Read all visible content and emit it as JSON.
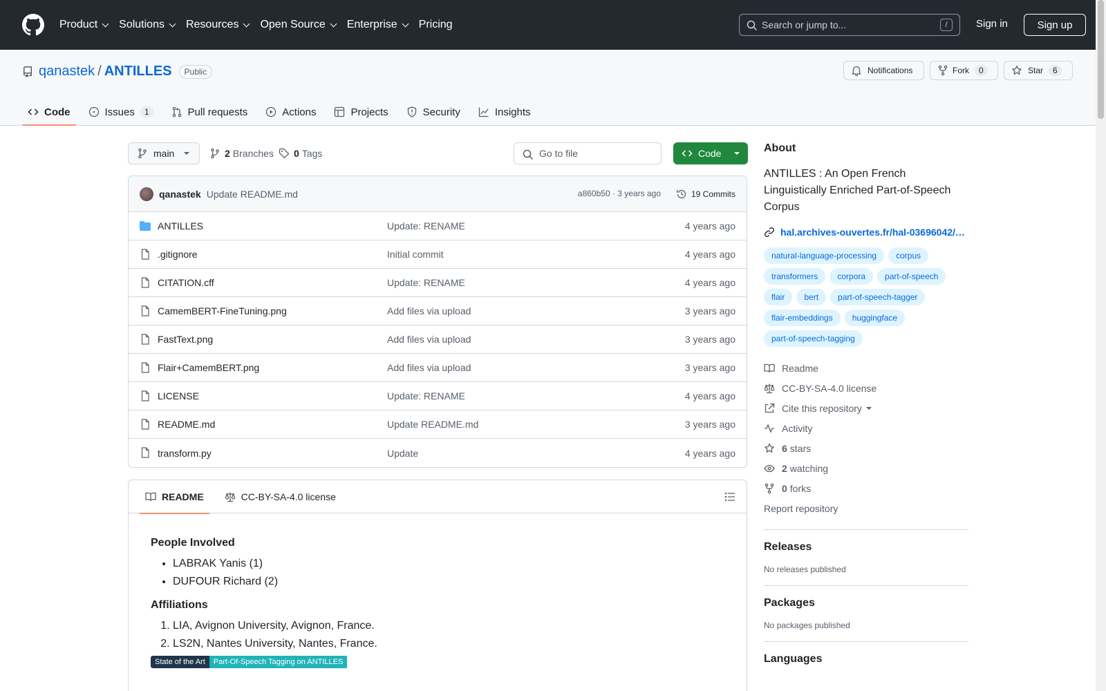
{
  "header": {
    "nav": [
      "Product",
      "Solutions",
      "Resources",
      "Open Source",
      "Enterprise",
      "Pricing"
    ],
    "search_placeholder": "Search or jump to...",
    "slash": "/",
    "signin": "Sign in",
    "signup": "Sign up"
  },
  "repo": {
    "owner": "qanastek",
    "sep": "/",
    "name": "ANTILLES",
    "visibility": "Public",
    "notifications": "Notifications",
    "fork_label": "Fork",
    "fork_count": "0",
    "star_label": "Star",
    "star_count": "6"
  },
  "tabs": [
    {
      "label": "Code"
    },
    {
      "label": "Issues",
      "count": "1"
    },
    {
      "label": "Pull requests"
    },
    {
      "label": "Actions"
    },
    {
      "label": "Projects"
    },
    {
      "label": "Security"
    },
    {
      "label": "Insights"
    }
  ],
  "bar": {
    "branch": "main",
    "branches_count": "2",
    "branches_label": "Branches",
    "tags_count": "0",
    "tags_label": "Tags",
    "goto_placeholder": "Go to file",
    "code_button": "Code"
  },
  "commit": {
    "author": "qanastek",
    "message": "Update README.md",
    "hash_time": "a860b50 · 3 years ago",
    "commits": "19 Commits"
  },
  "files": [
    {
      "name": "ANTILLES",
      "type": "dir",
      "message": "Update: RENAME",
      "age": "4 years ago"
    },
    {
      "name": ".gitignore",
      "type": "file",
      "message": "Initial commit",
      "age": "4 years ago"
    },
    {
      "name": "CITATION.cff",
      "type": "file",
      "message": "Update: RENAME",
      "age": "4 years ago"
    },
    {
      "name": "CamemBERT-FineTuning.png",
      "type": "file",
      "message": "Add files via upload",
      "age": "3 years ago"
    },
    {
      "name": "FastText.png",
      "type": "file",
      "message": "Add files via upload",
      "age": "3 years ago"
    },
    {
      "name": "Flair+CamemBERT.png",
      "type": "file",
      "message": "Add files via upload",
      "age": "3 years ago"
    },
    {
      "name": "LICENSE",
      "type": "file",
      "message": "Update: RENAME",
      "age": "4 years ago"
    },
    {
      "name": "README.md",
      "type": "file",
      "message": "Update README.md",
      "age": "3 years ago"
    },
    {
      "name": "transform.py",
      "type": "file",
      "message": "Update",
      "age": "4 years ago"
    }
  ],
  "readme": {
    "tab_readme": "README",
    "tab_license": "CC-BY-SA-4.0 license",
    "people_heading": "People Involved",
    "people": [
      "LABRAK Yanis (1)",
      "DUFOUR Richard (2)"
    ],
    "affil_heading": "Affiliations",
    "affiliations": [
      "LIA, Avignon University, Avignon, France.",
      "LS2N, Nantes University, Nantes, France."
    ],
    "badge_left": "State of the Art",
    "badge_right": "Part-Of-Speech Tagging on ANTILLES"
  },
  "about": {
    "heading": "About",
    "description": "ANTILLES : An Open French Linguistically Enriched Part-of-Speech Corpus",
    "link": "hal.archives-ouvertes.fr/hal-03696042/…",
    "topics": [
      "natural-language-processing",
      "corpus",
      "transformers",
      "corpora",
      "part-of-speech",
      "flair",
      "bert",
      "part-of-speech-tagger",
      "flair-embeddings",
      "huggingface",
      "part-of-speech-tagging"
    ],
    "readme": "Readme",
    "license": "CC-BY-SA-4.0 license",
    "cite": "Cite this repository",
    "activity": "Activity",
    "stars_n": "6",
    "stars": "stars",
    "watching_n": "2",
    "watching": "watching",
    "forks_n": "0",
    "forks": "forks",
    "report": "Report repository"
  },
  "releases": {
    "heading": "Releases",
    "text": "No releases published"
  },
  "packages": {
    "heading": "Packages",
    "text": "No packages published"
  },
  "languages": {
    "heading": "Languages"
  },
  "colors": {
    "accent": "#0969da",
    "green": "#1f883d",
    "tab_underline": "#fd8c73",
    "header_bg": "#24292f"
  }
}
